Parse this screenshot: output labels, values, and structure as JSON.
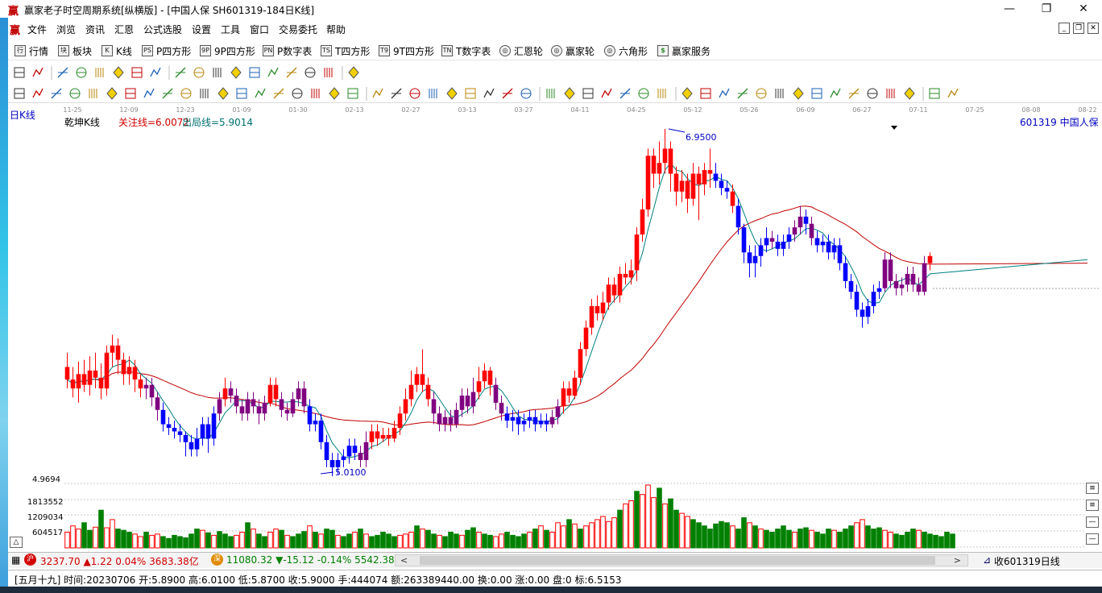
{
  "window": {
    "title": "赢家老子时空周期系统[纵横版] - [中国人保  SH601319-184日K线]",
    "logo_char": "赢",
    "min": "—",
    "restore": "❐",
    "close": "✕"
  },
  "menu": {
    "items": [
      "文件",
      "浏览",
      "资讯",
      "汇恩",
      "公式选股",
      "设置",
      "工具",
      "窗口",
      "交易委托",
      "帮助"
    ]
  },
  "toolbar1": {
    "items": [
      {
        "icon": "行",
        "label": "行情"
      },
      {
        "icon": "块",
        "label": "板块"
      },
      {
        "icon": "K",
        "label": "K线"
      },
      {
        "icon": "PS",
        "label": "P四方形"
      },
      {
        "icon": "9P",
        "label": "9P四方形"
      },
      {
        "icon": "PN",
        "label": "P数字表"
      },
      {
        "icon": "TS",
        "label": "T四方形"
      },
      {
        "icon": "T9",
        "label": "9T四方形"
      },
      {
        "icon": "TN",
        "label": "T数字表"
      },
      {
        "icon": "◎",
        "label": "汇恩轮"
      },
      {
        "icon": "◎",
        "label": "赢家轮"
      },
      {
        "icon": "◎",
        "label": "六角形"
      },
      {
        "icon": "$",
        "label": "赢家服务"
      }
    ]
  },
  "date_axis": [
    "11-25",
    "12-09",
    "12-23",
    "01-09",
    "01-30",
    "02-13",
    "02-27",
    "03-13",
    "03-27",
    "04-11",
    "04-25",
    "05-12",
    "05-26",
    "06-09",
    "06-27",
    "07-11",
    "07-25",
    "08-08",
    "08-22"
  ],
  "chart_header": {
    "period": "日K线",
    "indicator": "乾坤K线",
    "focus_line": "关注线=6.0072",
    "exit_line": "出局线=5.9014",
    "stock": "601319  中国人保"
  },
  "chart_data": {
    "type": "candlestick",
    "price_max_label": "6.9500",
    "price_min_label": "5.0100",
    "y_axis_min_label": "4.9694",
    "volume_labels": [
      "1813552",
      "1209034",
      "604517"
    ],
    "candles": [
      [
        5.62,
        5.55,
        5.7,
        5.5,
        "r"
      ],
      [
        5.55,
        5.5,
        5.62,
        5.45,
        "r"
      ],
      [
        5.5,
        5.58,
        5.65,
        5.42,
        "r"
      ],
      [
        5.58,
        5.52,
        5.66,
        5.48,
        "r"
      ],
      [
        5.52,
        5.6,
        5.68,
        5.46,
        "r"
      ],
      [
        5.6,
        5.56,
        5.7,
        5.5,
        "r"
      ],
      [
        5.56,
        5.5,
        5.64,
        5.44,
        "r"
      ],
      [
        5.5,
        5.7,
        5.74,
        5.46,
        "r"
      ],
      [
        5.7,
        5.74,
        5.8,
        5.62,
        "r"
      ],
      [
        5.74,
        5.66,
        5.78,
        5.58,
        "r"
      ],
      [
        5.66,
        5.58,
        5.7,
        5.52,
        "r"
      ],
      [
        5.58,
        5.62,
        5.68,
        5.52,
        "r"
      ],
      [
        5.62,
        5.55,
        5.66,
        5.48,
        "r"
      ],
      [
        5.55,
        5.5,
        5.58,
        5.45,
        "r"
      ],
      [
        5.5,
        5.52,
        5.56,
        5.44,
        "m"
      ],
      [
        5.52,
        5.45,
        5.56,
        5.4,
        "m"
      ],
      [
        5.45,
        5.38,
        5.48,
        5.32,
        "m"
      ],
      [
        5.38,
        5.3,
        5.42,
        5.26,
        "b"
      ],
      [
        5.3,
        5.28,
        5.34,
        5.24,
        "b"
      ],
      [
        5.28,
        5.26,
        5.32,
        5.22,
        "b"
      ],
      [
        5.26,
        5.24,
        5.3,
        5.2,
        "b"
      ],
      [
        5.24,
        5.2,
        5.26,
        5.12,
        "b"
      ],
      [
        5.2,
        5.16,
        5.24,
        5.12,
        "b"
      ],
      [
        5.16,
        5.22,
        5.28,
        5.12,
        "b"
      ],
      [
        5.22,
        5.3,
        5.34,
        5.18,
        "b"
      ],
      [
        5.3,
        5.22,
        5.34,
        5.14,
        "b"
      ],
      [
        5.22,
        5.36,
        5.4,
        5.18,
        "b"
      ],
      [
        5.36,
        5.44,
        5.48,
        5.32,
        "m"
      ],
      [
        5.44,
        5.5,
        5.56,
        5.4,
        "r"
      ],
      [
        5.5,
        5.46,
        5.54,
        5.42,
        "m"
      ],
      [
        5.46,
        5.4,
        5.5,
        5.36,
        "m"
      ],
      [
        5.4,
        5.36,
        5.44,
        5.32,
        "m"
      ],
      [
        5.36,
        5.44,
        5.48,
        5.32,
        "m"
      ],
      [
        5.44,
        5.4,
        5.48,
        5.36,
        "m"
      ],
      [
        5.4,
        5.36,
        5.44,
        5.3,
        "m"
      ],
      [
        5.36,
        5.42,
        5.46,
        5.32,
        "m"
      ],
      [
        5.42,
        5.52,
        5.56,
        5.4,
        "r"
      ],
      [
        5.52,
        5.44,
        5.56,
        5.4,
        "r"
      ],
      [
        5.44,
        5.38,
        5.48,
        5.34,
        "m"
      ],
      [
        5.38,
        5.36,
        5.42,
        5.32,
        "m"
      ],
      [
        5.36,
        5.44,
        5.48,
        5.34,
        "m"
      ],
      [
        5.44,
        5.5,
        5.54,
        5.4,
        "m"
      ],
      [
        5.5,
        5.4,
        5.54,
        5.36,
        "m"
      ],
      [
        5.4,
        5.3,
        5.44,
        5.26,
        "b"
      ],
      [
        5.3,
        5.32,
        5.36,
        5.26,
        "b"
      ],
      [
        5.32,
        5.2,
        5.36,
        5.16,
        "b"
      ],
      [
        5.2,
        5.1,
        5.24,
        5.06,
        "b"
      ],
      [
        5.1,
        5.06,
        5.14,
        5.01,
        "b"
      ],
      [
        5.06,
        5.1,
        5.14,
        5.02,
        "b"
      ],
      [
        5.1,
        5.12,
        5.16,
        5.06,
        "b"
      ],
      [
        5.12,
        5.18,
        5.22,
        5.08,
        "b"
      ],
      [
        5.18,
        5.14,
        5.22,
        5.1,
        "b"
      ],
      [
        5.14,
        5.1,
        5.18,
        5.06,
        "m"
      ],
      [
        5.1,
        5.2,
        5.26,
        5.06,
        "m"
      ],
      [
        5.2,
        5.26,
        5.3,
        5.16,
        "r"
      ],
      [
        5.26,
        5.22,
        5.3,
        5.18,
        "r"
      ],
      [
        5.22,
        5.24,
        5.28,
        5.2,
        "r"
      ],
      [
        5.24,
        5.22,
        5.28,
        5.18,
        "r"
      ],
      [
        5.22,
        5.28,
        5.32,
        5.2,
        "r"
      ],
      [
        5.28,
        5.36,
        5.4,
        5.24,
        "r"
      ],
      [
        5.36,
        5.44,
        5.5,
        5.32,
        "r"
      ],
      [
        5.44,
        5.52,
        5.6,
        5.4,
        "r"
      ],
      [
        5.52,
        5.58,
        5.62,
        5.48,
        "r"
      ],
      [
        5.58,
        5.52,
        5.72,
        5.48,
        "r"
      ],
      [
        5.52,
        5.44,
        5.56,
        5.4,
        "r"
      ],
      [
        5.44,
        5.36,
        5.48,
        5.3,
        "m"
      ],
      [
        5.36,
        5.3,
        5.4,
        5.26,
        "m"
      ],
      [
        5.3,
        5.34,
        5.38,
        5.26,
        "m"
      ],
      [
        5.34,
        5.3,
        5.38,
        5.26,
        "m"
      ],
      [
        5.3,
        5.38,
        5.42,
        5.28,
        "m"
      ],
      [
        5.38,
        5.46,
        5.5,
        5.34,
        "m"
      ],
      [
        5.46,
        5.4,
        5.5,
        5.36,
        "m"
      ],
      [
        5.4,
        5.48,
        5.56,
        5.36,
        "m"
      ],
      [
        5.48,
        5.54,
        5.62,
        5.44,
        "r"
      ],
      [
        5.54,
        5.6,
        5.64,
        5.5,
        "r"
      ],
      [
        5.6,
        5.52,
        5.62,
        5.46,
        "r"
      ],
      [
        5.52,
        5.42,
        5.56,
        5.38,
        "m"
      ],
      [
        5.42,
        5.36,
        5.46,
        5.32,
        "m"
      ],
      [
        5.36,
        5.32,
        5.4,
        5.28,
        "b"
      ],
      [
        5.32,
        5.34,
        5.38,
        5.26,
        "b"
      ],
      [
        5.34,
        5.3,
        5.38,
        5.24,
        "b"
      ],
      [
        5.3,
        5.32,
        5.36,
        5.26,
        "b"
      ],
      [
        5.32,
        5.34,
        5.38,
        5.28,
        "b"
      ],
      [
        5.34,
        5.3,
        5.38,
        5.26,
        "b"
      ],
      [
        5.3,
        5.32,
        5.36,
        5.28,
        "b"
      ],
      [
        5.32,
        5.3,
        5.36,
        5.26,
        "b"
      ],
      [
        5.3,
        5.34,
        5.38,
        5.28,
        "m"
      ],
      [
        5.34,
        5.4,
        5.44,
        5.3,
        "m"
      ],
      [
        5.4,
        5.5,
        5.54,
        5.36,
        "r"
      ],
      [
        5.5,
        5.46,
        5.54,
        5.42,
        "r"
      ],
      [
        5.46,
        5.56,
        5.6,
        5.44,
        "r"
      ],
      [
        5.56,
        5.72,
        5.76,
        5.52,
        "r"
      ],
      [
        5.72,
        5.84,
        5.88,
        5.68,
        "r"
      ],
      [
        5.84,
        5.96,
        6.0,
        5.8,
        "r"
      ],
      [
        5.96,
        5.92,
        6.02,
        5.88,
        "r"
      ],
      [
        5.92,
        5.98,
        6.04,
        5.88,
        "r"
      ],
      [
        5.98,
        6.08,
        6.12,
        5.94,
        "r"
      ],
      [
        6.08,
        6.02,
        6.12,
        5.98,
        "r"
      ],
      [
        6.02,
        6.14,
        6.18,
        5.98,
        "r"
      ],
      [
        6.14,
        6.12,
        6.2,
        6.08,
        "r"
      ],
      [
        6.12,
        6.16,
        6.22,
        6.08,
        "r"
      ],
      [
        6.16,
        6.36,
        6.4,
        6.1,
        "r"
      ],
      [
        6.36,
        6.5,
        6.56,
        6.32,
        "r"
      ],
      [
        6.5,
        6.8,
        6.84,
        6.46,
        "r"
      ],
      [
        6.8,
        6.7,
        6.84,
        6.62,
        "r"
      ],
      [
        6.7,
        6.76,
        6.88,
        6.64,
        "r"
      ],
      [
        6.76,
        6.84,
        6.95,
        6.7,
        "r"
      ],
      [
        6.84,
        6.7,
        6.88,
        6.6,
        "r"
      ],
      [
        6.7,
        6.6,
        6.74,
        6.52,
        "r"
      ],
      [
        6.6,
        6.66,
        6.72,
        6.54,
        "r"
      ],
      [
        6.66,
        6.56,
        6.7,
        6.48,
        "r"
      ],
      [
        6.56,
        6.7,
        6.76,
        6.52,
        "r"
      ],
      [
        6.7,
        6.64,
        6.74,
        6.44,
        "r"
      ],
      [
        6.64,
        6.72,
        6.76,
        6.58,
        "r"
      ],
      [
        6.72,
        6.7,
        6.84,
        6.62,
        "r"
      ],
      [
        6.7,
        6.66,
        6.76,
        6.62,
        "b"
      ],
      [
        6.66,
        6.62,
        6.7,
        6.58,
        "b"
      ],
      [
        6.62,
        6.6,
        6.66,
        6.56,
        "b"
      ],
      [
        6.6,
        6.52,
        6.64,
        6.48,
        "r"
      ],
      [
        6.52,
        6.4,
        6.56,
        6.36,
        "b"
      ],
      [
        6.4,
        6.26,
        6.42,
        6.2,
        "b"
      ],
      [
        6.26,
        6.2,
        6.3,
        6.12,
        "b"
      ],
      [
        6.2,
        6.24,
        6.3,
        6.12,
        "b"
      ],
      [
        6.24,
        6.3,
        6.34,
        6.18,
        "b"
      ],
      [
        6.3,
        6.34,
        6.4,
        6.26,
        "b"
      ],
      [
        6.34,
        6.32,
        6.38,
        6.28,
        "m"
      ],
      [
        6.32,
        6.28,
        6.36,
        6.24,
        "b"
      ],
      [
        6.28,
        6.32,
        6.36,
        6.24,
        "b"
      ],
      [
        6.32,
        6.36,
        6.4,
        6.28,
        "b"
      ],
      [
        6.36,
        6.4,
        6.44,
        6.32,
        "m"
      ],
      [
        6.4,
        6.46,
        6.52,
        6.36,
        "m"
      ],
      [
        6.46,
        6.42,
        6.5,
        6.36,
        "b"
      ],
      [
        6.42,
        6.34,
        6.46,
        6.3,
        "m"
      ],
      [
        6.34,
        6.3,
        6.38,
        6.26,
        "b"
      ],
      [
        6.3,
        6.32,
        6.36,
        6.26,
        "b"
      ],
      [
        6.32,
        6.26,
        6.36,
        6.22,
        "b"
      ],
      [
        6.26,
        6.3,
        6.34,
        6.22,
        "b"
      ],
      [
        6.3,
        6.2,
        6.34,
        6.16,
        "b"
      ],
      [
        6.2,
        6.1,
        6.24,
        6.06,
        "b"
      ],
      [
        6.1,
        6.04,
        6.14,
        6.0,
        "b"
      ],
      [
        6.04,
        5.94,
        6.08,
        5.9,
        "b"
      ],
      [
        5.94,
        5.9,
        5.98,
        5.84,
        "b"
      ],
      [
        5.9,
        5.96,
        6.0,
        5.86,
        "b"
      ],
      [
        5.96,
        6.04,
        6.08,
        5.92,
        "b"
      ],
      [
        6.04,
        6.06,
        6.1,
        6.0,
        "b"
      ],
      [
        6.06,
        6.22,
        6.26,
        6.04,
        "m"
      ],
      [
        6.22,
        6.1,
        6.26,
        6.06,
        "m"
      ],
      [
        6.1,
        6.06,
        6.14,
        6.02,
        "m"
      ],
      [
        6.06,
        6.08,
        6.12,
        6.02,
        "m"
      ],
      [
        6.08,
        6.14,
        6.18,
        6.04,
        "m"
      ],
      [
        6.14,
        6.08,
        6.18,
        6.04,
        "m"
      ],
      [
        6.08,
        6.04,
        6.12,
        6.02,
        "m"
      ],
      [
        6.04,
        6.2,
        6.24,
        6.02,
        "m"
      ],
      [
        6.2,
        6.24,
        6.26,
        6.16,
        "r"
      ]
    ],
    "volumes": [
      0.25,
      0.35,
      0.3,
      0.4,
      0.28,
      0.33,
      0.6,
      0.32,
      0.45,
      0.3,
      0.28,
      0.25,
      0.22,
      0.18,
      0.25,
      0.2,
      0.22,
      0.18,
      0.15,
      0.2,
      0.18,
      0.16,
      0.22,
      0.3,
      0.28,
      0.24,
      0.2,
      0.26,
      0.22,
      0.18,
      0.2,
      0.25,
      0.4,
      0.3,
      0.22,
      0.18,
      0.25,
      0.3,
      0.28,
      0.2,
      0.18,
      0.22,
      0.26,
      0.35,
      0.25,
      0.22,
      0.3,
      0.28,
      0.2,
      0.18,
      0.22,
      0.25,
      0.3,
      0.22,
      0.18,
      0.2,
      0.25,
      0.22,
      0.18,
      0.2,
      0.22,
      0.25,
      0.35,
      0.3,
      0.28,
      0.22,
      0.2,
      0.18,
      0.25,
      0.22,
      0.2,
      0.28,
      0.32,
      0.25,
      0.22,
      0.2,
      0.18,
      0.22,
      0.25,
      0.2,
      0.18,
      0.22,
      0.25,
      0.3,
      0.35,
      0.28,
      0.25,
      0.4,
      0.35,
      0.45,
      0.38,
      0.3,
      0.35,
      0.4,
      0.45,
      0.5,
      0.42,
      0.48,
      0.6,
      0.7,
      0.75,
      0.9,
      0.85,
      1.0,
      0.8,
      0.95,
      0.7,
      0.78,
      0.6,
      0.55,
      0.5,
      0.45,
      0.4,
      0.35,
      0.3,
      0.38,
      0.42,
      0.4,
      0.35,
      0.3,
      0.48,
      0.4,
      0.35,
      0.3,
      0.28,
      0.25,
      0.3,
      0.35,
      0.28,
      0.25,
      0.3,
      0.32,
      0.28,
      0.25,
      0.22,
      0.3,
      0.28,
      0.25,
      0.3,
      0.35,
      0.4,
      0.45,
      0.35,
      0.3,
      0.32,
      0.28,
      0.25,
      0.22,
      0.2,
      0.25,
      0.3,
      0.28,
      0.25,
      0.22,
      0.2,
      0.18,
      0.25,
      0.22
    ],
    "volume_colors": "rrrggrgrrgggrrgrrgggggggrgrgggrrgrggrrgrgggrgrggrggrgrgggggrrrgrggrgggrggrggrrggggrgrgrrrgrgrrrrrrgrrgrrrgrggrrgggggggrggrgrgggggrggrgggrgggrrgggrrggggrgg"
  },
  "index_bar": {
    "sh_icon": "沪",
    "sh": "3237.70 ▲1.22 0.04% 3683.38亿",
    "sz_icon": "深",
    "sz": "11080.32 ▼-15.12 -0.14% 5542.38",
    "right_text": "收601319日线"
  },
  "status": "[五月十九] 时间:20230706 开:5.8900 高:6.0100 低:5.8700 收:5.9000 手:444074 额:263389440.00 换:0.00 涨:0.00 盘:0 标:6.5153",
  "colors": {
    "up": "#ff0000",
    "down": "#0000ff",
    "mid": "#800080",
    "vol_up": "#ff0000",
    "vol_down": "#008000"
  }
}
